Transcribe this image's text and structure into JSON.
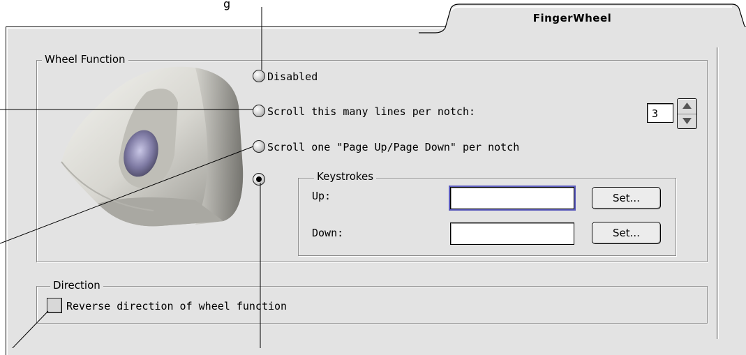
{
  "tab": {
    "label": "FingerWheel"
  },
  "top_caption_fragment": "g",
  "wheel_function": {
    "title": "Wheel Function",
    "options": [
      {
        "label": "Disabled",
        "selected": false
      },
      {
        "label": "Scroll this many lines per notch:",
        "selected": false
      },
      {
        "label": "Scroll one \"Page Up/Page Down\" per notch",
        "selected": false
      },
      {
        "label": "",
        "selected": true
      }
    ],
    "lines_value": "3"
  },
  "keystrokes": {
    "title": "Keystrokes",
    "up_label": "Up:",
    "up_value": "",
    "down_label": "Down:",
    "down_value": "",
    "set_up_label": "Set...",
    "set_down_label": "Set..."
  },
  "direction": {
    "title": "Direction",
    "checkbox_label": "Reverse direction of wheel function",
    "checked": false
  },
  "icons": {
    "mouse": "mouse-image",
    "stepper_up": "triangle-up-icon",
    "stepper_down": "triangle-down-icon"
  },
  "colors": {
    "panel_bg": "#e3e3e3",
    "focus_ring": "#5b5bbd"
  }
}
